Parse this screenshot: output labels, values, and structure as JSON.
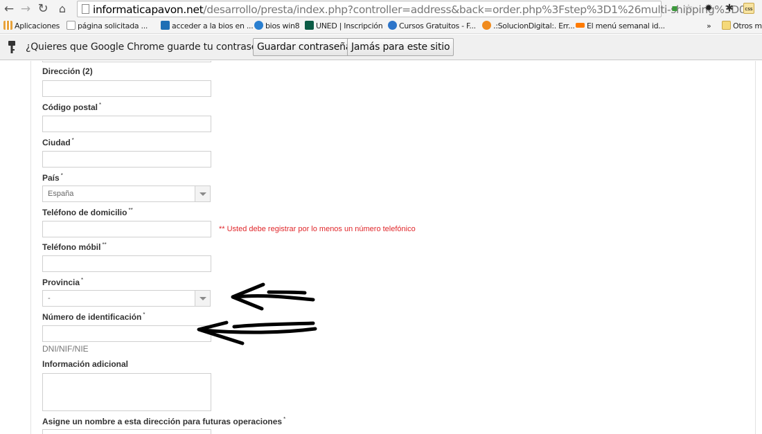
{
  "browser": {
    "url_host": "informaticapavon.net",
    "url_path": "/desarrollo/presta/index.php?controller=address&back=order.php%3Fstep%3D1%26multi-shipping%3D0"
  },
  "bookmarks": [
    {
      "label": "Aplicaciones",
      "icon": "apps-grid-icon",
      "color": "#e8a23a"
    },
    {
      "label": "página solicitada ...",
      "icon": "page-icon",
      "color": "#ffffff"
    },
    {
      "label": "acceder a la bios en ...",
      "icon": "t-icon",
      "color": "#1f6fb5"
    },
    {
      "label": "bios win8",
      "icon": "hp-icon",
      "color": "#2a7fd0"
    },
    {
      "label": "UNED | Inscripción",
      "icon": "u-icon",
      "color": "#0b5b45"
    },
    {
      "label": "Cursos Gratuitos - F...",
      "icon": "gear-blue-icon",
      "color": "#2c74c9"
    },
    {
      "label": ".:SolucionDigital:. Err...",
      "icon": "sd-icon",
      "color": "#f08a1c"
    },
    {
      "label": "El menú semanal id...",
      "icon": "rtve-icon",
      "color": "#ff7b00"
    },
    {
      "label": "»",
      "icon": "",
      "color": ""
    },
    {
      "label": "Otros m",
      "icon": "folder-icon",
      "color": "#f5d97a"
    }
  ],
  "infobar": {
    "message": "¿Quieres que Google Chrome guarde tu contraseña?",
    "save_label": "Guardar contraseña",
    "never_label": "Jamás para este sitio"
  },
  "form": {
    "address2_label": "Dirección (2)",
    "postcode_label": "Código postal",
    "city_label": "Ciudad",
    "country_label": "País",
    "country_value": "España",
    "home_phone_label": "Teléfono de domicilio",
    "phone_error": "** Usted debe registrar por lo menos un número telefónico",
    "mobile_label": "Teléfono móbil",
    "province_label": "Provincia",
    "province_value": "-",
    "id_number_label": "Número de identificación",
    "id_hint": "DNI/NIF/NIE",
    "other_label": "Información adicional",
    "alias_label": "Asigne un nombre a esta dirección para futuras operaciones",
    "required_mark": "*",
    "phone_mark": "**"
  },
  "colors": {
    "error": "#e0262a",
    "annotation": "#000000"
  }
}
